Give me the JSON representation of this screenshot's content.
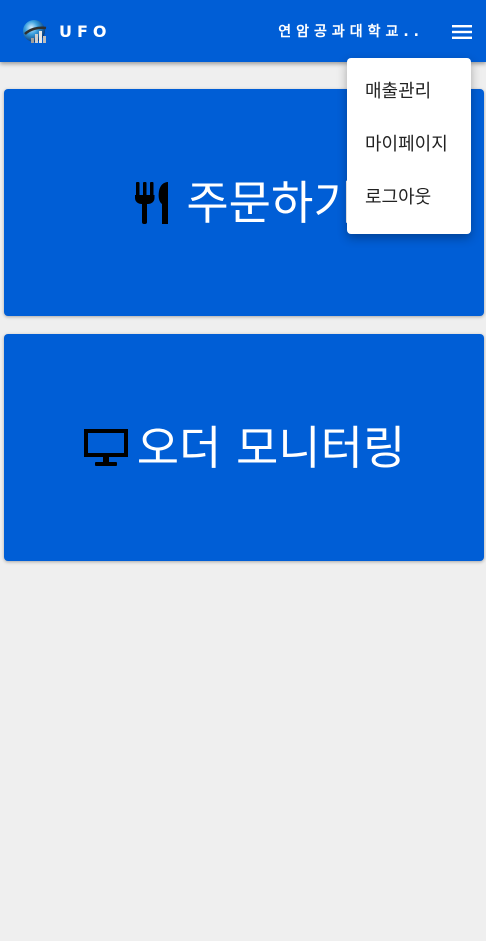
{
  "header": {
    "logo_icon": "globe-logo-icon",
    "app_title": "UFO",
    "school_name": "연암공과대학교..",
    "menu_icon": "hamburger-menu-icon",
    "background": "#005ed6"
  },
  "cards": [
    {
      "label": "주문하기",
      "icon": "utensils-icon"
    },
    {
      "label": "오더 모니터링",
      "icon": "monitor-icon"
    }
  ],
  "menu": {
    "items": [
      {
        "label": "매출관리"
      },
      {
        "label": "마이페이지"
      },
      {
        "label": "로그아웃"
      }
    ]
  }
}
